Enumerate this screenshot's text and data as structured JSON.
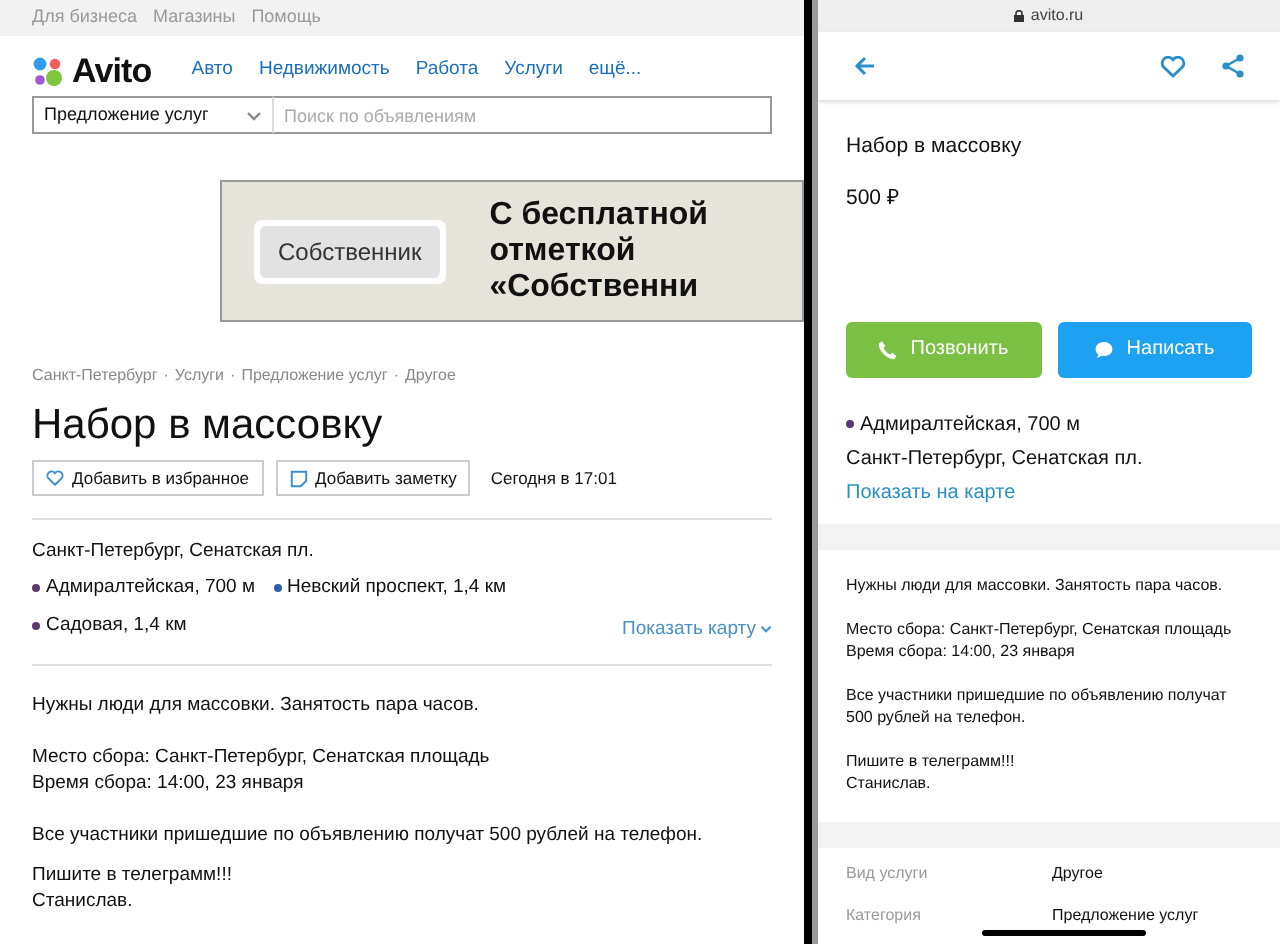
{
  "desktop": {
    "top_links": [
      "Для бизнеса",
      "Магазины",
      "Помощь"
    ],
    "logo": "Avito",
    "nav": [
      "Авто",
      "Недвижимость",
      "Работа",
      "Услуги",
      "ещё..."
    ],
    "category_select": "Предложение услуг",
    "search": {
      "placeholder": "Поиск по объявлениям"
    },
    "banner": {
      "badge": "Собственник",
      "headline": [
        "С бесплатной",
        "отметкой",
        "«Собственни"
      ]
    },
    "breadcrumbs": [
      "Санкт-Петербург",
      "Услуги",
      "Предложение услуг",
      "Другое"
    ],
    "breadcrumb_separator": "·",
    "title": "Набор в массовку",
    "actions": [
      {
        "kind": "favorite",
        "label": "Добавить в избранное"
      },
      {
        "kind": "note",
        "label": "Добавить заметку"
      }
    ],
    "posted": "Сегодня в 17:01",
    "address": "Санкт-Петербург, Сенатская пл.",
    "metro": [
      {
        "name": "Адмиралтейская, 700 м",
        "color": "#5b3a6e"
      },
      {
        "name": "Невский проспект, 1,4 км",
        "color": "#2f5fa8"
      },
      {
        "name": "Садовая, 1,4 км",
        "color": "#5b3a6e"
      }
    ],
    "show_map": "Показать карту",
    "description": [
      [
        "Нужны люди для массовки. Занятость пара часов."
      ],
      [
        "Место сбора: Санкт-Петербург, Сенатская площадь",
        "Время сбора: 14:00, 23 января"
      ],
      [
        "Все участники пришедшие по объявлению получат 500 рублей на телефон."
      ],
      [
        "Пишите в телеграмм!!!",
        "Станислав."
      ]
    ]
  },
  "mobile": {
    "url": "avito.ru",
    "title": "Набор в массовку",
    "price": "500 ₽",
    "buttons": [
      {
        "kind": "call",
        "label": "Позвонить"
      },
      {
        "kind": "message",
        "label": "Написать"
      }
    ],
    "metro": [
      {
        "name": "Адмиралтейская, 700 м",
        "color": "#5b3a6e"
      }
    ],
    "address": "Санкт-Петербург, Сенатская пл.",
    "show_map": "Показать на карте",
    "description": [
      [
        "Нужны люди для массовки. Занятость пара часов."
      ],
      [
        "Место сбора: Санкт-Петербург, Сенатская площадь",
        "Время сбора: 14:00, 23 января"
      ],
      [
        "Все участники пришедшие по объявлению получат 500 рублей на телефон."
      ],
      [
        "Пишите в телеграмм!!!",
        "Станислав."
      ]
    ],
    "params": [
      {
        "label": "Вид услуги",
        "value": "Другое"
      },
      {
        "label": "Категория",
        "value": "Предложение услуг"
      }
    ]
  }
}
